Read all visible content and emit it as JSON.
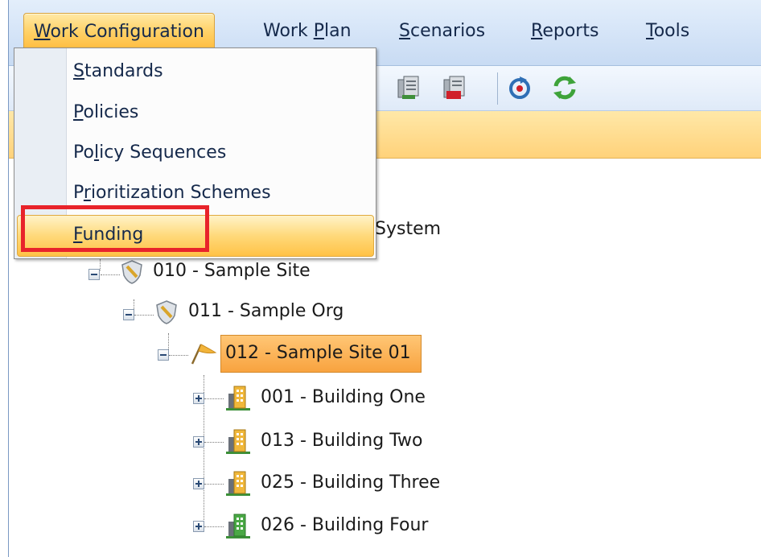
{
  "menubar": {
    "items": [
      {
        "label": "Work Configuration",
        "mnemonic": "W",
        "rest": "ork Configuration",
        "active": true
      },
      {
        "label": "Work Plan",
        "pre": "Work ",
        "mnemonic": "P",
        "rest": "lan"
      },
      {
        "label": "Scenarios",
        "mnemonic": "S",
        "rest": "cenarios"
      },
      {
        "label": "Reports",
        "mnemonic": "R",
        "rest": "eports"
      },
      {
        "label": "Tools",
        "mnemonic": "T",
        "rest": "ools"
      }
    ]
  },
  "toolbar": {
    "icons": [
      "copy-document-icon",
      "delete-document-icon",
      "refresh-icon",
      "sync-icon"
    ]
  },
  "dropdown": {
    "items": [
      {
        "label": "Standards",
        "mnemonic": "S",
        "rest": "tandards"
      },
      {
        "label": "Policies",
        "mnemonic": "P",
        "rest": "olicies"
      },
      {
        "label": "Policy Sequences",
        "pre": "Po",
        "mnemonic": "l",
        "rest": "icy Sequences"
      },
      {
        "label": "Prioritization Schemes",
        "pre": "P",
        "mnemonic": "r",
        "rest": "ioritization Schemes"
      },
      {
        "label": "Funding",
        "mnemonic": "F",
        "rest": "unding",
        "highlighted": true
      }
    ]
  },
  "tree": {
    "root_partial": "System",
    "nodes": [
      {
        "label": "010 - Sample Site",
        "icon": "shield-icon",
        "expanded": true
      },
      {
        "label": "011 - Sample Org",
        "icon": "shield-icon",
        "expanded": true
      },
      {
        "label": "012 - Sample Site 01",
        "icon": "flag-icon",
        "expanded": true,
        "selected": true
      },
      {
        "label": "001 - Building One",
        "icon": "building-icon",
        "expanded": false
      },
      {
        "label": "013 - Building Two",
        "icon": "building-icon",
        "expanded": false
      },
      {
        "label": "025 - Building Three",
        "icon": "building-icon",
        "expanded": false
      },
      {
        "label": "026 - Building Four",
        "icon": "building-icon",
        "expanded": false
      }
    ]
  },
  "colors": {
    "callout": "#e8232a",
    "selection": "#f8a33f",
    "menu_active": "#ffbb3c"
  }
}
